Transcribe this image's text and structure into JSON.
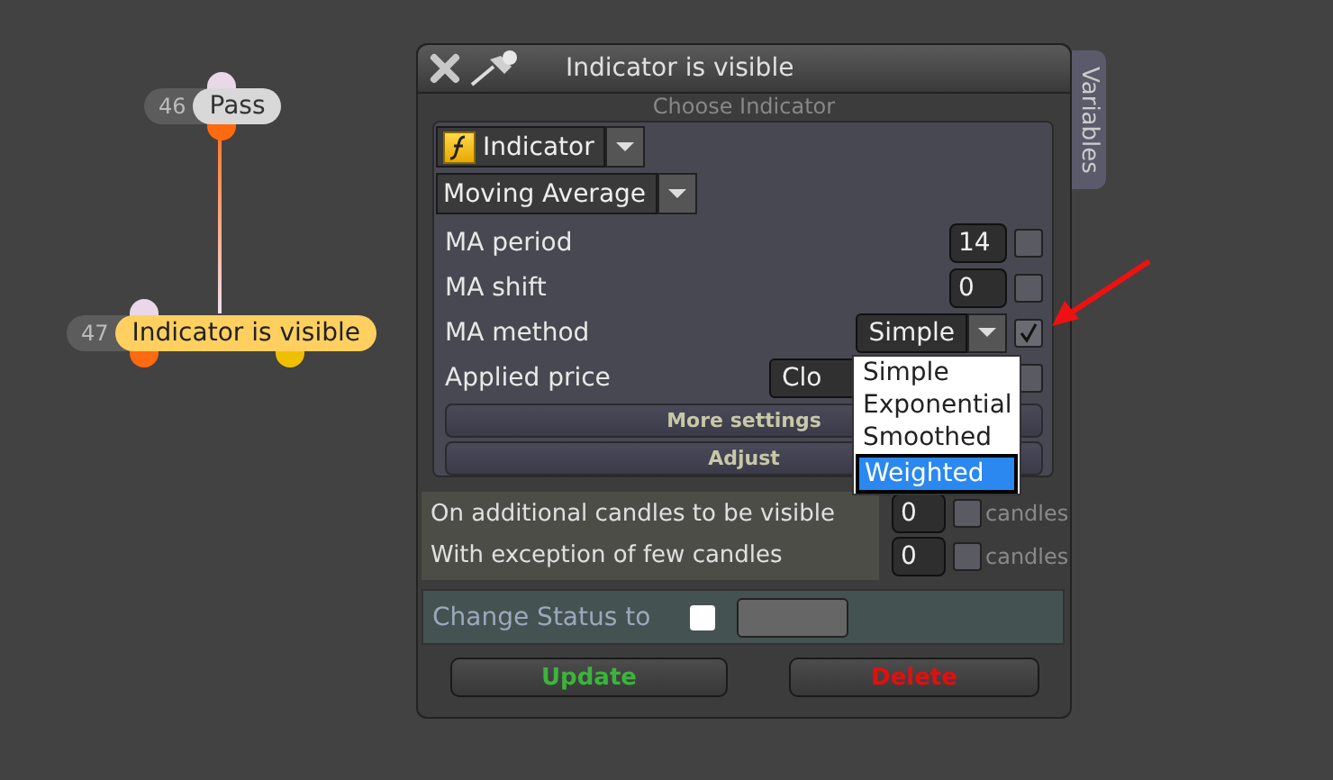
{
  "canvas": {
    "nodes": [
      {
        "number": "46",
        "label": "Pass",
        "selected": false
      },
      {
        "number": "47",
        "label": "Indicator is visible",
        "selected": true
      }
    ]
  },
  "dialog": {
    "title": "Indicator is visible",
    "side_tab": "Variables",
    "section_title": "Choose Indicator",
    "indicator_type": "Indicator",
    "indicator": "Moving Average",
    "parameters": [
      {
        "label": "MA period",
        "kind": "input",
        "value": "14",
        "checked": false
      },
      {
        "label": "MA shift",
        "kind": "input",
        "value": "0",
        "checked": false
      },
      {
        "label": "MA method",
        "kind": "select",
        "value": "Simple",
        "checked": true
      },
      {
        "label": "Applied price",
        "kind": "select",
        "value": "Clo",
        "checked": false
      }
    ],
    "more_settings": "More settings",
    "adjust": "Adjust",
    "dropdown": {
      "options": [
        {
          "label": "Simple",
          "selected": false
        },
        {
          "label": "Exponential",
          "selected": false
        },
        {
          "label": "Smoothed",
          "selected": false
        },
        {
          "label": "Weighted",
          "selected": true
        }
      ]
    },
    "candle_rows": [
      {
        "label": "On additional candles to be visible",
        "value": "0",
        "checked": false,
        "unit": "candles"
      },
      {
        "label": "With exception of few candles",
        "value": "0",
        "checked": false,
        "unit": "candles"
      }
    ],
    "change_status": {
      "label": "Change Status to",
      "checked": false
    },
    "buttons": [
      {
        "label": "Update",
        "kind": "update"
      },
      {
        "label": "Delete",
        "kind": "delete"
      }
    ]
  }
}
